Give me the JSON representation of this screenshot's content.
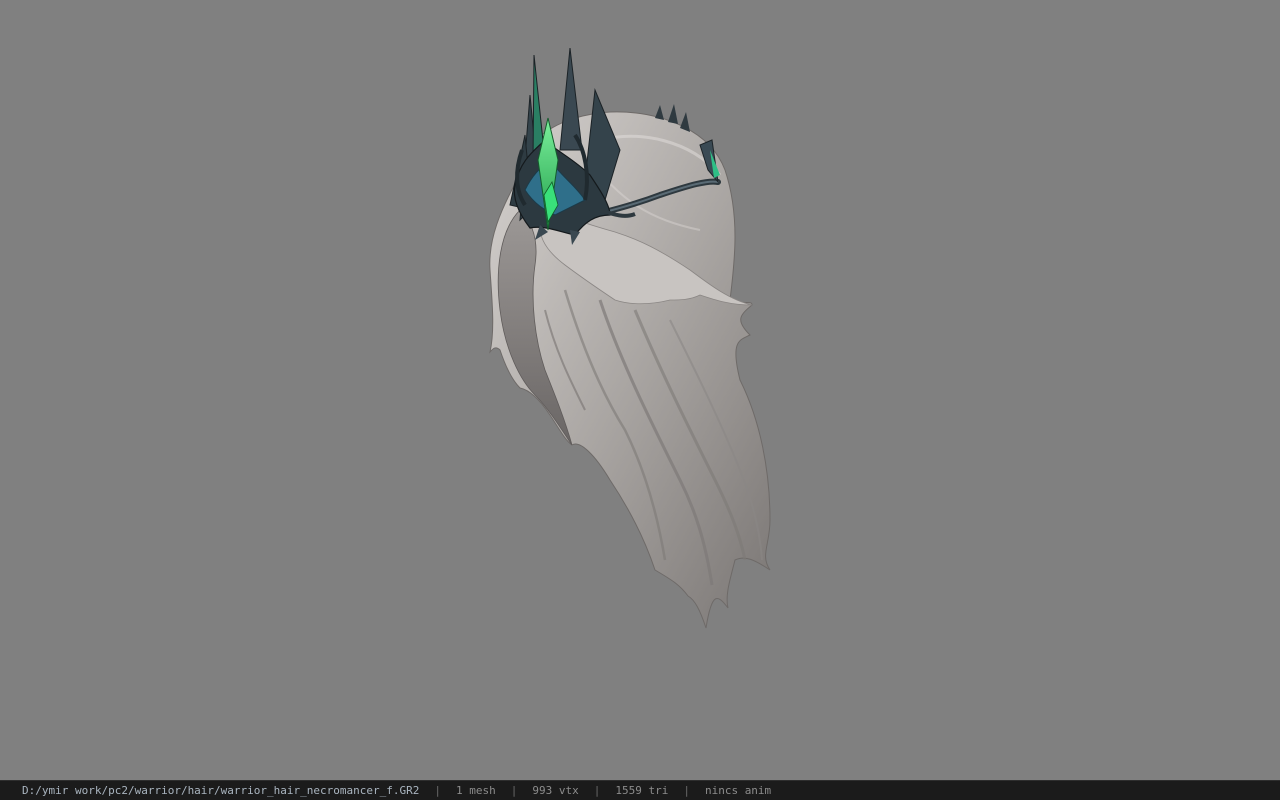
{
  "viewer": {
    "background_color": "#808080",
    "model_icon": "warrior-hair-necromancer-crown-model"
  },
  "status_bar": {
    "file_path": "D:/ymir work/pc2/warrior/hair/warrior_hair_necromancer_f.GR2",
    "mesh_count": "1 mesh",
    "vertex_count": "993 vtx",
    "triangle_count": "1559 tri",
    "anim_status": "nincs anim",
    "separator": "|"
  },
  "colors": {
    "hair": "#b9b4b1",
    "crown_metal": "#3c4a52",
    "crown_gem": "#3ddc6f",
    "status_bg": "#1b1b1b"
  }
}
